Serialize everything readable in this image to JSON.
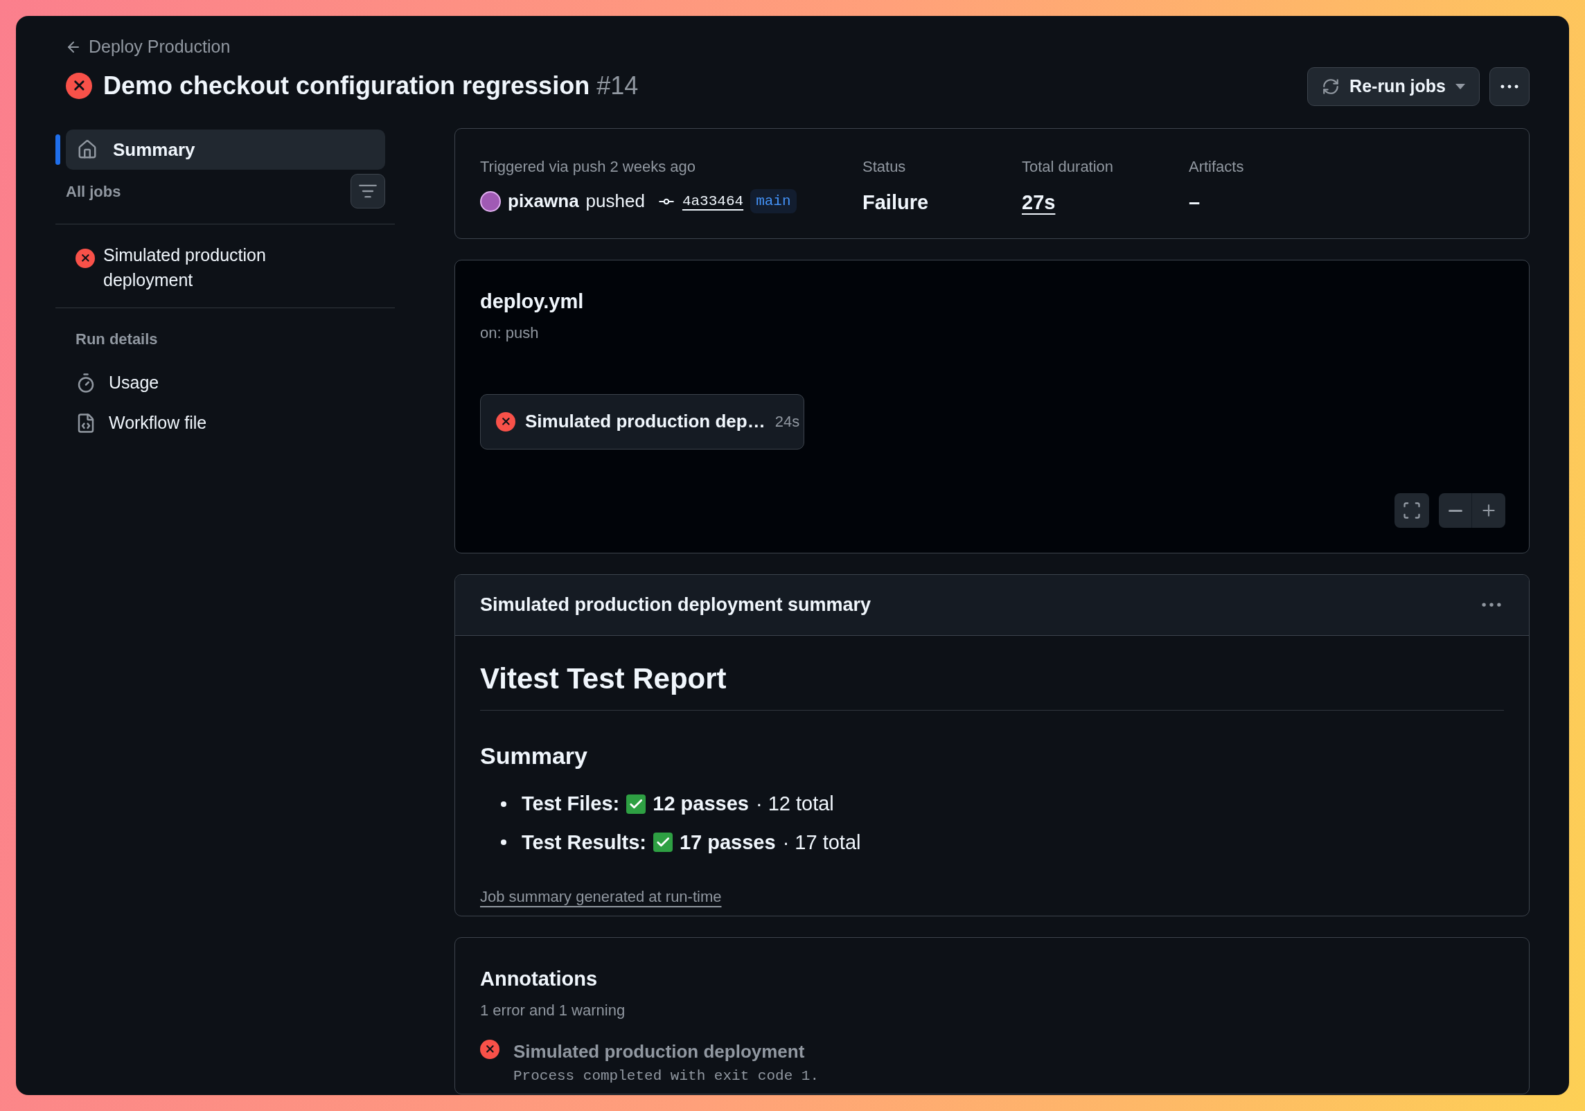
{
  "breadcrumb": "Deploy Production",
  "title": {
    "kind": "failure",
    "text": "Demo checkout configuration regression",
    "number": "#14"
  },
  "actions": {
    "rerun": "Re-run jobs"
  },
  "sidebar": {
    "items": [
      {
        "label": "Summary",
        "selected": true
      }
    ],
    "jobs_heading": "All jobs",
    "jobs": [
      {
        "name": "Simulated production deployment",
        "kind": "failure"
      }
    ],
    "details_heading": "Run details",
    "details": [
      {
        "label": "Usage",
        "kind": "usage"
      },
      {
        "label": "Workflow file",
        "kind": "workflow"
      }
    ]
  },
  "run_info": {
    "trigger_label": "Triggered via push 2 weeks ago",
    "actor": "pixawna",
    "action": "pushed",
    "commit": "4a33464",
    "branch": "main",
    "fields": [
      {
        "label": "Status",
        "value": "Failure",
        "underlined": false
      },
      {
        "label": "Total duration",
        "value": "27s",
        "underlined": true
      },
      {
        "label": "Artifacts",
        "value": "–",
        "underlined": false
      }
    ]
  },
  "workflow": {
    "file": "deploy.yml",
    "trigger": "on: push",
    "jobs": [
      {
        "name": "Simulated production dep…",
        "duration": "24s",
        "kind": "failure"
      }
    ]
  },
  "job_summary": {
    "title": "Simulated production deployment summary",
    "report_title": "Vitest Test Report",
    "section": "Summary",
    "items": [
      {
        "label": "Test Files:",
        "kind": "success",
        "passes": "12 passes",
        "total": "· 12 total"
      },
      {
        "label": "Test Results:",
        "kind": "success",
        "passes": "17 passes",
        "total": "· 17 total"
      }
    ],
    "footer": "Job summary generated at run-time"
  },
  "annotations": {
    "title": "Annotations",
    "subtitle": "1 error and 1 warning",
    "items": [
      {
        "kind": "failure",
        "title": "Simulated production deployment",
        "message": "Process completed with exit code 1."
      }
    ]
  }
}
